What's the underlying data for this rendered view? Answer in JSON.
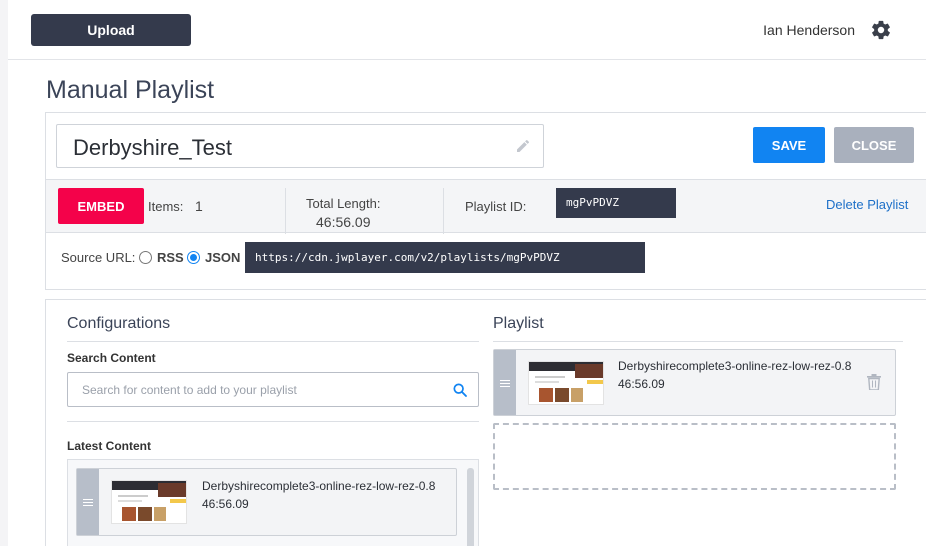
{
  "topbar": {
    "upload_label": "Upload",
    "user_name": "Ian Henderson",
    "settings_icon": "gear-icon"
  },
  "page": {
    "title": "Manual Playlist"
  },
  "playlist": {
    "name": "Derbyshire_Test",
    "save_label": "SAVE",
    "close_label": "CLOSE",
    "embed_label": "EMBED",
    "items_label": "Items:",
    "items_count": "1",
    "total_length_label": "Total Length:",
    "total_length": "46:56.09",
    "id_label": "Playlist ID:",
    "id": "mgPvPDVZ",
    "delete_label": "Delete Playlist",
    "source_label": "Source URL:",
    "rss_label": "RSS",
    "json_label": "JSON",
    "selected_source": "JSON",
    "source_url": "https://cdn.jwplayer.com/v2/playlists/mgPvPDVZ"
  },
  "configurations": {
    "title": "Configurations",
    "search_label": "Search Content",
    "search_placeholder": "Search for content to add to your playlist",
    "latest_label": "Latest Content",
    "latest_items": [
      {
        "title": "Derbyshirecomplete3-online-rez-low-rez-0.8",
        "duration": "46:56.09"
      }
    ]
  },
  "playlist_panel": {
    "title": "Playlist",
    "items": [
      {
        "title": "Derbyshirecomplete3-online-rez-low-rez-0.8",
        "duration": "46:56.09"
      }
    ]
  },
  "colors": {
    "primary_blue": "#1184f2",
    "embed_red": "#f4024a",
    "dark_navy": "#343a4c",
    "close_gray": "#a9b0bd",
    "link_blue": "#1e70c8"
  }
}
